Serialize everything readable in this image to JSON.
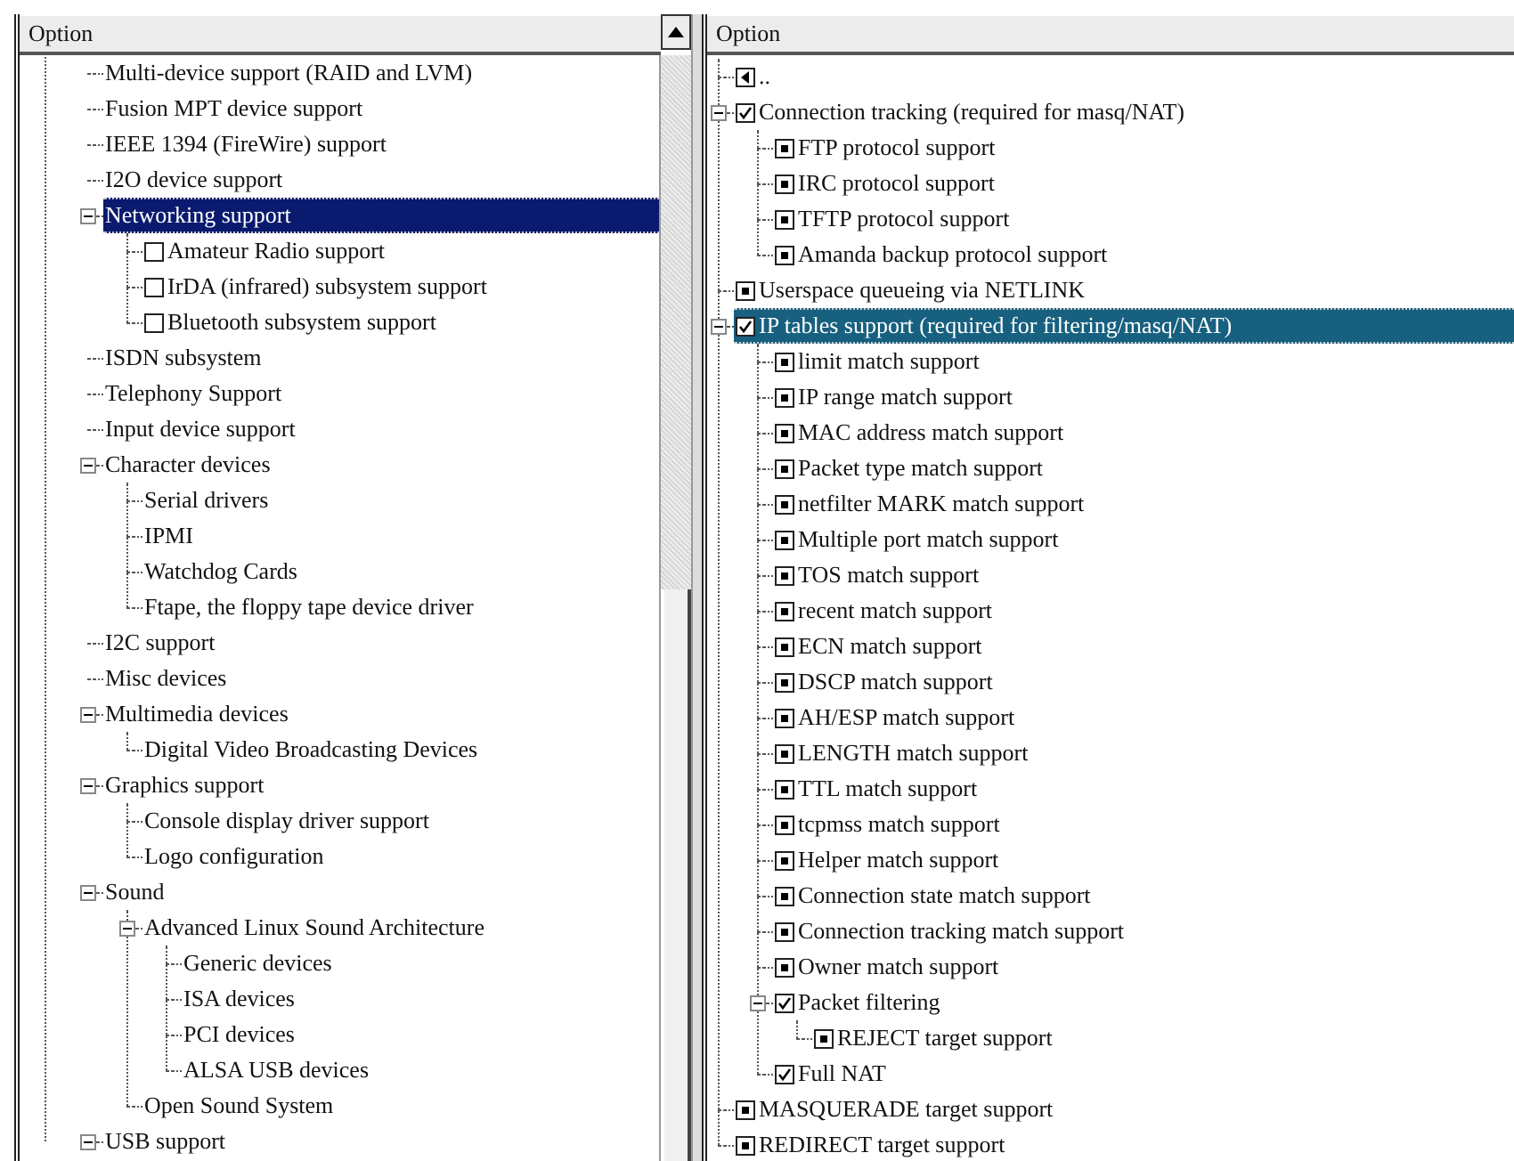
{
  "left_pane": {
    "header": "Option",
    "items": [
      {
        "label": "Multi-device support (RAID and LVM)",
        "selected": false
      },
      {
        "label": "Fusion MPT device support",
        "selected": false
      },
      {
        "label": "IEEE 1394 (FireWire) support",
        "selected": false
      },
      {
        "label": "I2O device support",
        "selected": false
      },
      {
        "label": "Networking support",
        "selected": true,
        "expanded": true,
        "children": [
          {
            "label": "Amateur Radio support",
            "kind": "checkbox",
            "checked": false,
            "selected": false
          },
          {
            "label": "IrDA (infrared) subsystem support",
            "kind": "checkbox",
            "checked": false,
            "selected": false
          },
          {
            "label": "Bluetooth subsystem support",
            "kind": "checkbox",
            "checked": false,
            "selected": false
          }
        ]
      },
      {
        "label": "ISDN subsystem",
        "selected": false
      },
      {
        "label": "Telephony Support",
        "selected": false
      },
      {
        "label": "Input device support",
        "selected": false
      },
      {
        "label": "Character devices",
        "selected": false,
        "expanded": true,
        "children": [
          {
            "label": "Serial drivers",
            "selected": false
          },
          {
            "label": "IPMI",
            "selected": false
          },
          {
            "label": "Watchdog Cards",
            "selected": false
          },
          {
            "label": "Ftape, the floppy tape device driver",
            "selected": false
          }
        ]
      },
      {
        "label": "I2C support",
        "selected": false
      },
      {
        "label": "Misc devices",
        "selected": false
      },
      {
        "label": "Multimedia devices",
        "selected": false,
        "expanded": true,
        "children": [
          {
            "label": "Digital Video Broadcasting Devices",
            "selected": false
          }
        ]
      },
      {
        "label": "Graphics support",
        "selected": false,
        "expanded": true,
        "children": [
          {
            "label": "Console display driver support",
            "selected": false
          },
          {
            "label": "Logo configuration",
            "selected": false
          }
        ]
      },
      {
        "label": "Sound",
        "selected": false,
        "expanded": true,
        "children": [
          {
            "label": "Advanced Linux Sound Architecture",
            "selected": false,
            "expanded": true,
            "children": [
              {
                "label": "Generic devices",
                "selected": false
              },
              {
                "label": "ISA devices",
                "selected": false
              },
              {
                "label": "PCI devices",
                "selected": false
              },
              {
                "label": "ALSA USB devices",
                "selected": false
              }
            ]
          },
          {
            "label": "Open Sound System",
            "selected": false
          }
        ]
      },
      {
        "label": "USB support",
        "selected": false,
        "expanded": true
      }
    ]
  },
  "right_pane": {
    "header": "Option",
    "items": [
      {
        "label": "..",
        "kind": "parent",
        "selected": false
      },
      {
        "label": "Connection tracking (required for masq/NAT)",
        "kind": "checkbox",
        "checked": true,
        "selected": false,
        "expanded": true,
        "children": [
          {
            "label": "FTP protocol support",
            "kind": "module",
            "selected": false
          },
          {
            "label": "IRC protocol support",
            "kind": "module",
            "selected": false
          },
          {
            "label": "TFTP protocol support",
            "kind": "module",
            "selected": false
          },
          {
            "label": "Amanda backup protocol support",
            "kind": "module",
            "selected": false
          }
        ]
      },
      {
        "label": "Userspace queueing via NETLINK",
        "kind": "module",
        "selected": false
      },
      {
        "label": "IP tables support (required for filtering/masq/NAT)",
        "kind": "checkbox",
        "checked": true,
        "selected": true,
        "expanded": true,
        "children": [
          {
            "label": "limit match support",
            "kind": "module",
            "selected": false
          },
          {
            "label": "IP range match support",
            "kind": "module",
            "selected": false
          },
          {
            "label": "MAC address match support",
            "kind": "module",
            "selected": false
          },
          {
            "label": "Packet type match support",
            "kind": "module",
            "selected": false
          },
          {
            "label": "netfilter MARK match support",
            "kind": "module",
            "selected": false
          },
          {
            "label": "Multiple port match support",
            "kind": "module",
            "selected": false
          },
          {
            "label": "TOS match support",
            "kind": "module",
            "selected": false
          },
          {
            "label": "recent match support",
            "kind": "module",
            "selected": false
          },
          {
            "label": "ECN match support",
            "kind": "module",
            "selected": false
          },
          {
            "label": "DSCP match support",
            "kind": "module",
            "selected": false
          },
          {
            "label": "AH/ESP match support",
            "kind": "module",
            "selected": false
          },
          {
            "label": "LENGTH match support",
            "kind": "module",
            "selected": false
          },
          {
            "label": "TTL match support",
            "kind": "module",
            "selected": false
          },
          {
            "label": "tcpmss match support",
            "kind": "module",
            "selected": false
          },
          {
            "label": "Helper match support",
            "kind": "module",
            "selected": false
          },
          {
            "label": "Connection state match support",
            "kind": "module",
            "selected": false
          },
          {
            "label": "Connection tracking match support",
            "kind": "module",
            "selected": false
          },
          {
            "label": "Owner match support",
            "kind": "module",
            "selected": false
          },
          {
            "label": "Packet filtering",
            "kind": "checkbox",
            "checked": true,
            "selected": false,
            "expanded": true,
            "children": [
              {
                "label": "REJECT target support",
                "kind": "module",
                "selected": false
              }
            ]
          },
          {
            "label": "Full NAT",
            "kind": "checkbox",
            "checked": true,
            "selected": false
          }
        ]
      },
      {
        "label": "MASQUERADE target support",
        "kind": "module",
        "selected": false
      },
      {
        "label": "REDIRECT target support",
        "kind": "module",
        "selected": false
      }
    ]
  }
}
